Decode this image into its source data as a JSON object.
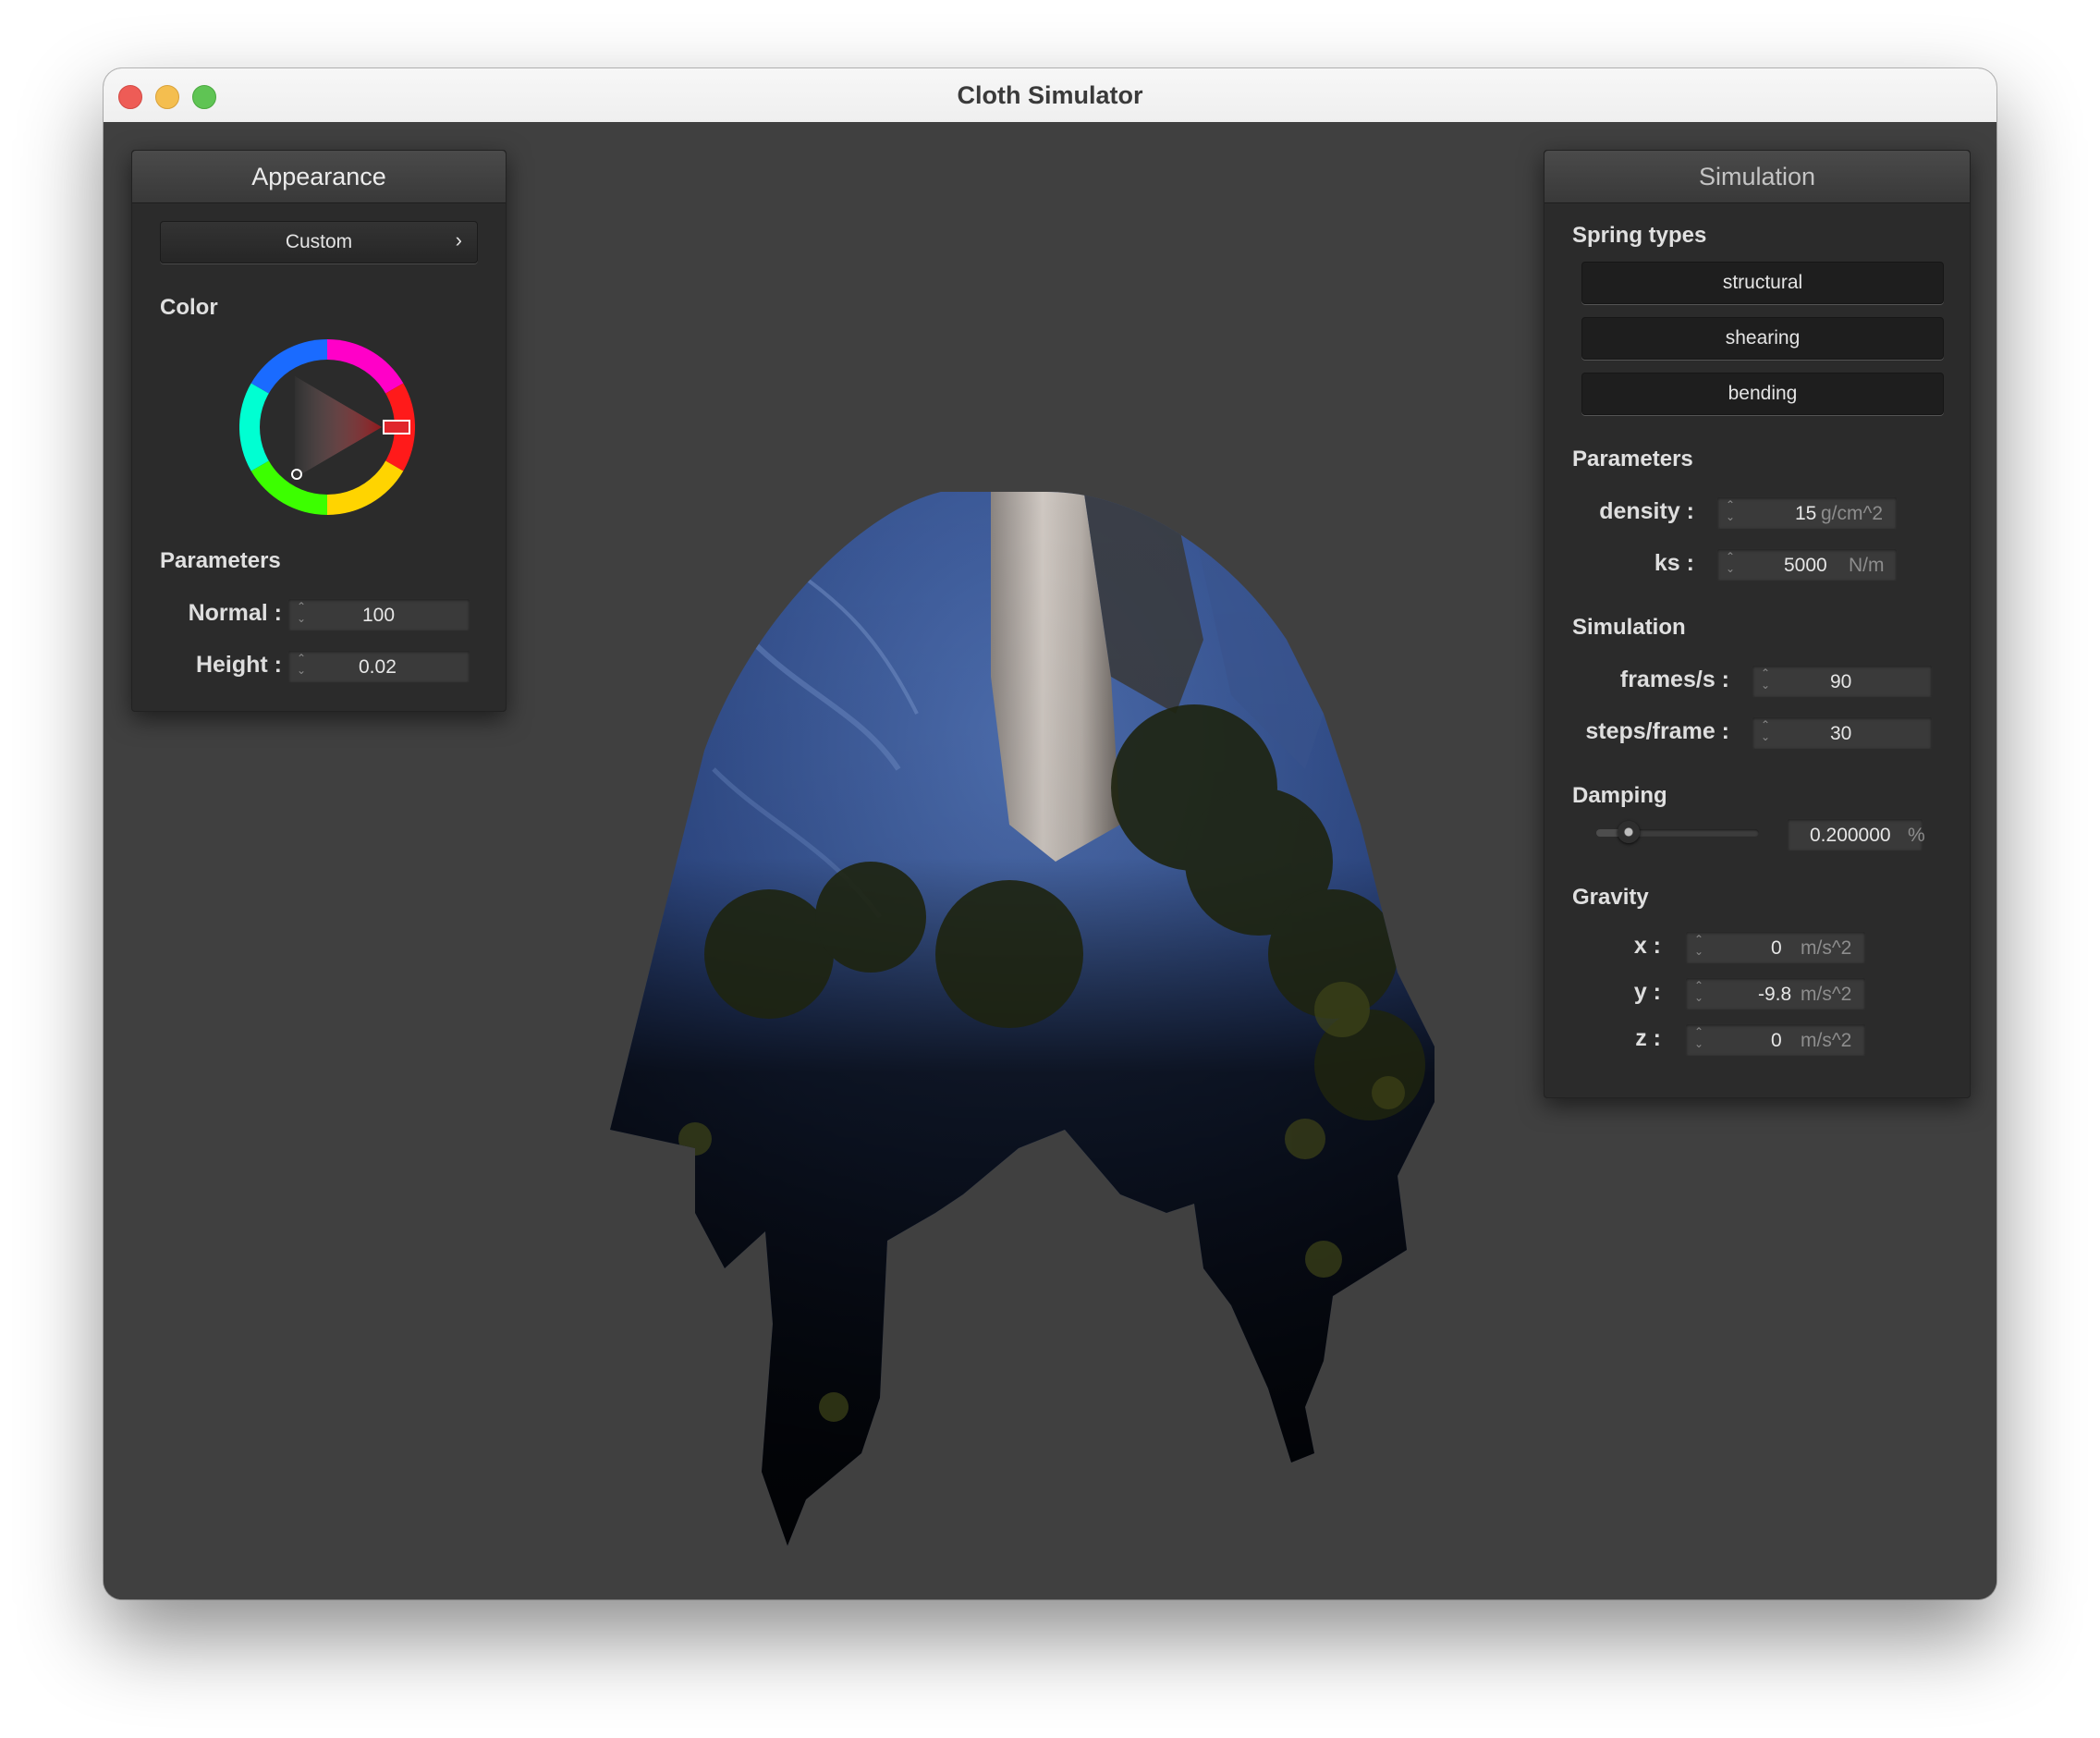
{
  "window": {
    "title": "Cloth Simulator"
  },
  "appearance": {
    "header": "Appearance",
    "preset_button": "Custom",
    "preset_chevron": "›",
    "color_label": "Color",
    "parameters_label": "Parameters",
    "normal_label": "Normal :",
    "normal_value": "100",
    "height_label": "Height :",
    "height_value": "0.02",
    "selected_color": "#e0262c"
  },
  "simulation": {
    "header": "Simulation",
    "spring_types_label": "Spring types",
    "spring_types": [
      "structural",
      "shearing",
      "bending"
    ],
    "parameters_label": "Parameters",
    "density_label": "density :",
    "density_value": "15",
    "density_unit": "g/cm^2",
    "ks_label": "ks :",
    "ks_value": "5000",
    "ks_unit": "N/m",
    "simulation_label": "Simulation",
    "fps_label": "frames/s :",
    "fps_value": "90",
    "steps_label": "steps/frame :",
    "steps_value": "30",
    "damping_label": "Damping",
    "damping_value": "0.200000",
    "damping_unit": "%",
    "damping_slider_fraction": 0.2,
    "gravity_label": "Gravity",
    "gravity_x_label": "x :",
    "gravity_x_value": "0",
    "gravity_y_label": "y :",
    "gravity_y_value": "-9.8",
    "gravity_z_label": "z :",
    "gravity_z_value": "0",
    "gravity_unit": "m/s^2"
  }
}
